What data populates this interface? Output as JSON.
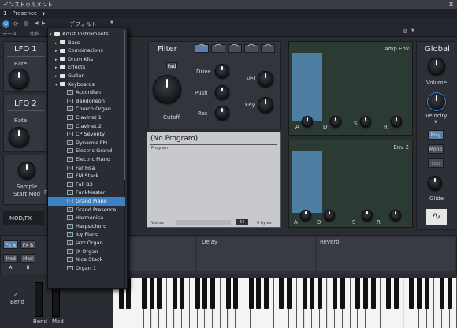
{
  "window": {
    "title": "インストゥルメント",
    "close": "✕"
  },
  "preset": {
    "name": "1 - Presence"
  },
  "toolbar": {
    "data_label": "データ",
    "compare": "比較",
    "default_preset": "デフォルト"
  },
  "dropdown": {
    "root": "Artist Instruments",
    "folders": [
      "Bass",
      "Combinations",
      "Drum Kits",
      "Effects",
      "Guitar",
      "Keyboards"
    ],
    "programs": [
      "Accordian",
      "Bandoneon",
      "Church Organ",
      "Clavinet 1",
      "Clavinet 2",
      "CP Seventy",
      "Dynamic FM",
      "Electric Grand",
      "Electric Piano",
      "Far Fisa",
      "FM Stack",
      "Full B3",
      "FunkMaster",
      "Grand Piano",
      "Grand Presence",
      "Harmonica",
      "Harpsichord",
      "Icy Piano",
      "Jazz Organ",
      "JX Organ",
      "Nice Stack",
      "Organ 1"
    ],
    "selected": "Grand Piano"
  },
  "lfo1": {
    "title": "LFO 1",
    "rate": "Rate"
  },
  "lfo2": {
    "title": "LFO 2",
    "rate": "Rate"
  },
  "sample": {
    "label1": "Sample",
    "label2": "Start Mod",
    "fix": "Fi"
  },
  "modfx": {
    "label": "MOD/FX",
    "fxa": "FX A",
    "fxb": "FX B",
    "moda": "Mod A",
    "modb": "Mod B"
  },
  "filter": {
    "title": "Filter",
    "drive": "Drive",
    "cutoff": "Cutoff",
    "vel": "Vel",
    "key": "Key",
    "res": "Res",
    "pad": "Pad",
    "push": "Push"
  },
  "program": {
    "name": "(No Program)",
    "header": "Program",
    "voices": "Voices",
    "voice_count": "64",
    "size": "0 bytes"
  },
  "amp_env": {
    "title": "Amp Env",
    "a": "A",
    "d": "D",
    "s": "S",
    "r": "R"
  },
  "env2": {
    "title": "Env 2",
    "a": "A",
    "d": "D",
    "s": "S",
    "r": "R"
  },
  "global": {
    "title": "Global",
    "volume": "Volume",
    "velocity": "Velocity",
    "poly": "Poly",
    "mono": "Mono",
    "glide": "Glide",
    "legato": "Leg"
  },
  "fx": {
    "delay": "Delay",
    "reverb": "Reverb"
  },
  "bend": {
    "value": "2",
    "label": "Bend",
    "bend": "Bend",
    "mod": "Mod"
  }
}
